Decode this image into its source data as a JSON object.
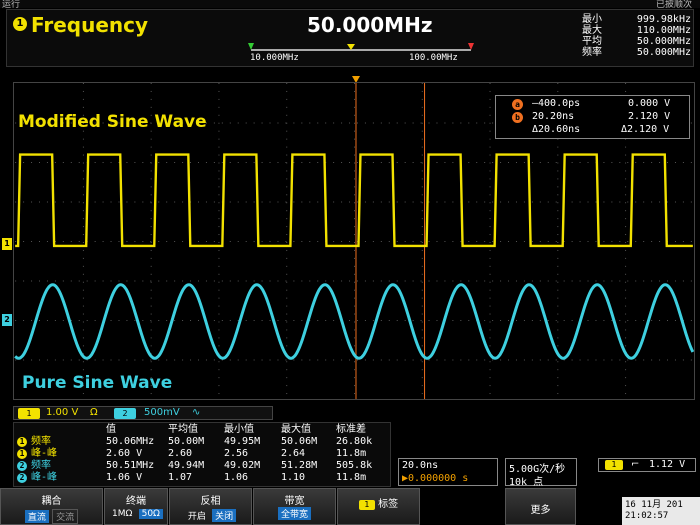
{
  "status": {
    "left": "运行",
    "right": "已披顺次"
  },
  "measurement": {
    "badge": "1",
    "title": "Frequency",
    "value": "50.000MHz",
    "scale_min": "10.000MHz",
    "scale_max": "100.00MHz",
    "stats": [
      {
        "label": "最小",
        "value": "999.98kHz"
      },
      {
        "label": "最大",
        "value": "110.00MHz"
      },
      {
        "label": "平均",
        "value": "50.000MHz"
      },
      {
        "label": "频率",
        "value": "50.000MHz"
      }
    ]
  },
  "cursors": {
    "a_label": "a",
    "b_label": "b",
    "a_time": "–400.0ps",
    "a_volt": "0.000 V",
    "b_time": "20.20ns",
    "b_volt": "2.120 V",
    "delta_time": "Δ20.60ns",
    "delta_volt": "Δ2.120 V"
  },
  "traces": {
    "ch1_label": "Modified Sine Wave",
    "ch2_label": "Pure Sine Wave",
    "ch1_color": "#f2e100",
    "ch2_color": "#3ed0e0",
    "ch1_marker": "1",
    "ch2_marker": "2"
  },
  "channel_info": {
    "ch1_badge": "1",
    "ch1_scale": "1.00 V",
    "ch1_ohm": "Ω",
    "ch2_badge": "2",
    "ch2_scale": "500mV",
    "ch2_bw": "∿"
  },
  "table": {
    "headers": [
      "值",
      "平均值",
      "最小值",
      "最大值",
      "标准差"
    ],
    "rows": [
      {
        "ch": "1",
        "name": "频率",
        "cells": [
          "50.06MHz",
          "50.00M",
          "49.95M",
          "50.06M",
          "26.80k"
        ]
      },
      {
        "ch": "1",
        "name": "峰-峰",
        "cells": [
          "2.60 V",
          "2.60",
          "2.56",
          "2.64",
          "11.8m"
        ]
      },
      {
        "ch": "2",
        "name": "频率",
        "cells": [
          "50.51MHz",
          "49.94M",
          "49.02M",
          "51.28M",
          "505.8k"
        ]
      },
      {
        "ch": "2",
        "name": "峰-峰",
        "cells": [
          "1.06 V",
          "1.07",
          "1.06",
          "1.10",
          "11.8m"
        ]
      }
    ]
  },
  "horizontal": {
    "timebase": "20.0ns",
    "position": "▶0.000000 s",
    "rate": "5.00G次/秒",
    "points": "10k 点"
  },
  "trigger": {
    "badge": "1",
    "slope": "⌐",
    "level": "1.12 V"
  },
  "softkeys": {
    "coupling": {
      "title": "耦合",
      "on": "直流",
      "off": "交流"
    },
    "termination": {
      "title": "终端",
      "off": "1MΩ",
      "on": "50Ω"
    },
    "invert": {
      "title": "反相",
      "off": "开启",
      "on": "关闭"
    },
    "bandwidth": {
      "title": "带宽",
      "value": "全带宽"
    },
    "label": {
      "badge": "1",
      "title": "标签"
    },
    "more": {
      "title": "更多"
    }
  },
  "datetime": {
    "date": "16 11月 201",
    "time": "21:02:57"
  }
}
